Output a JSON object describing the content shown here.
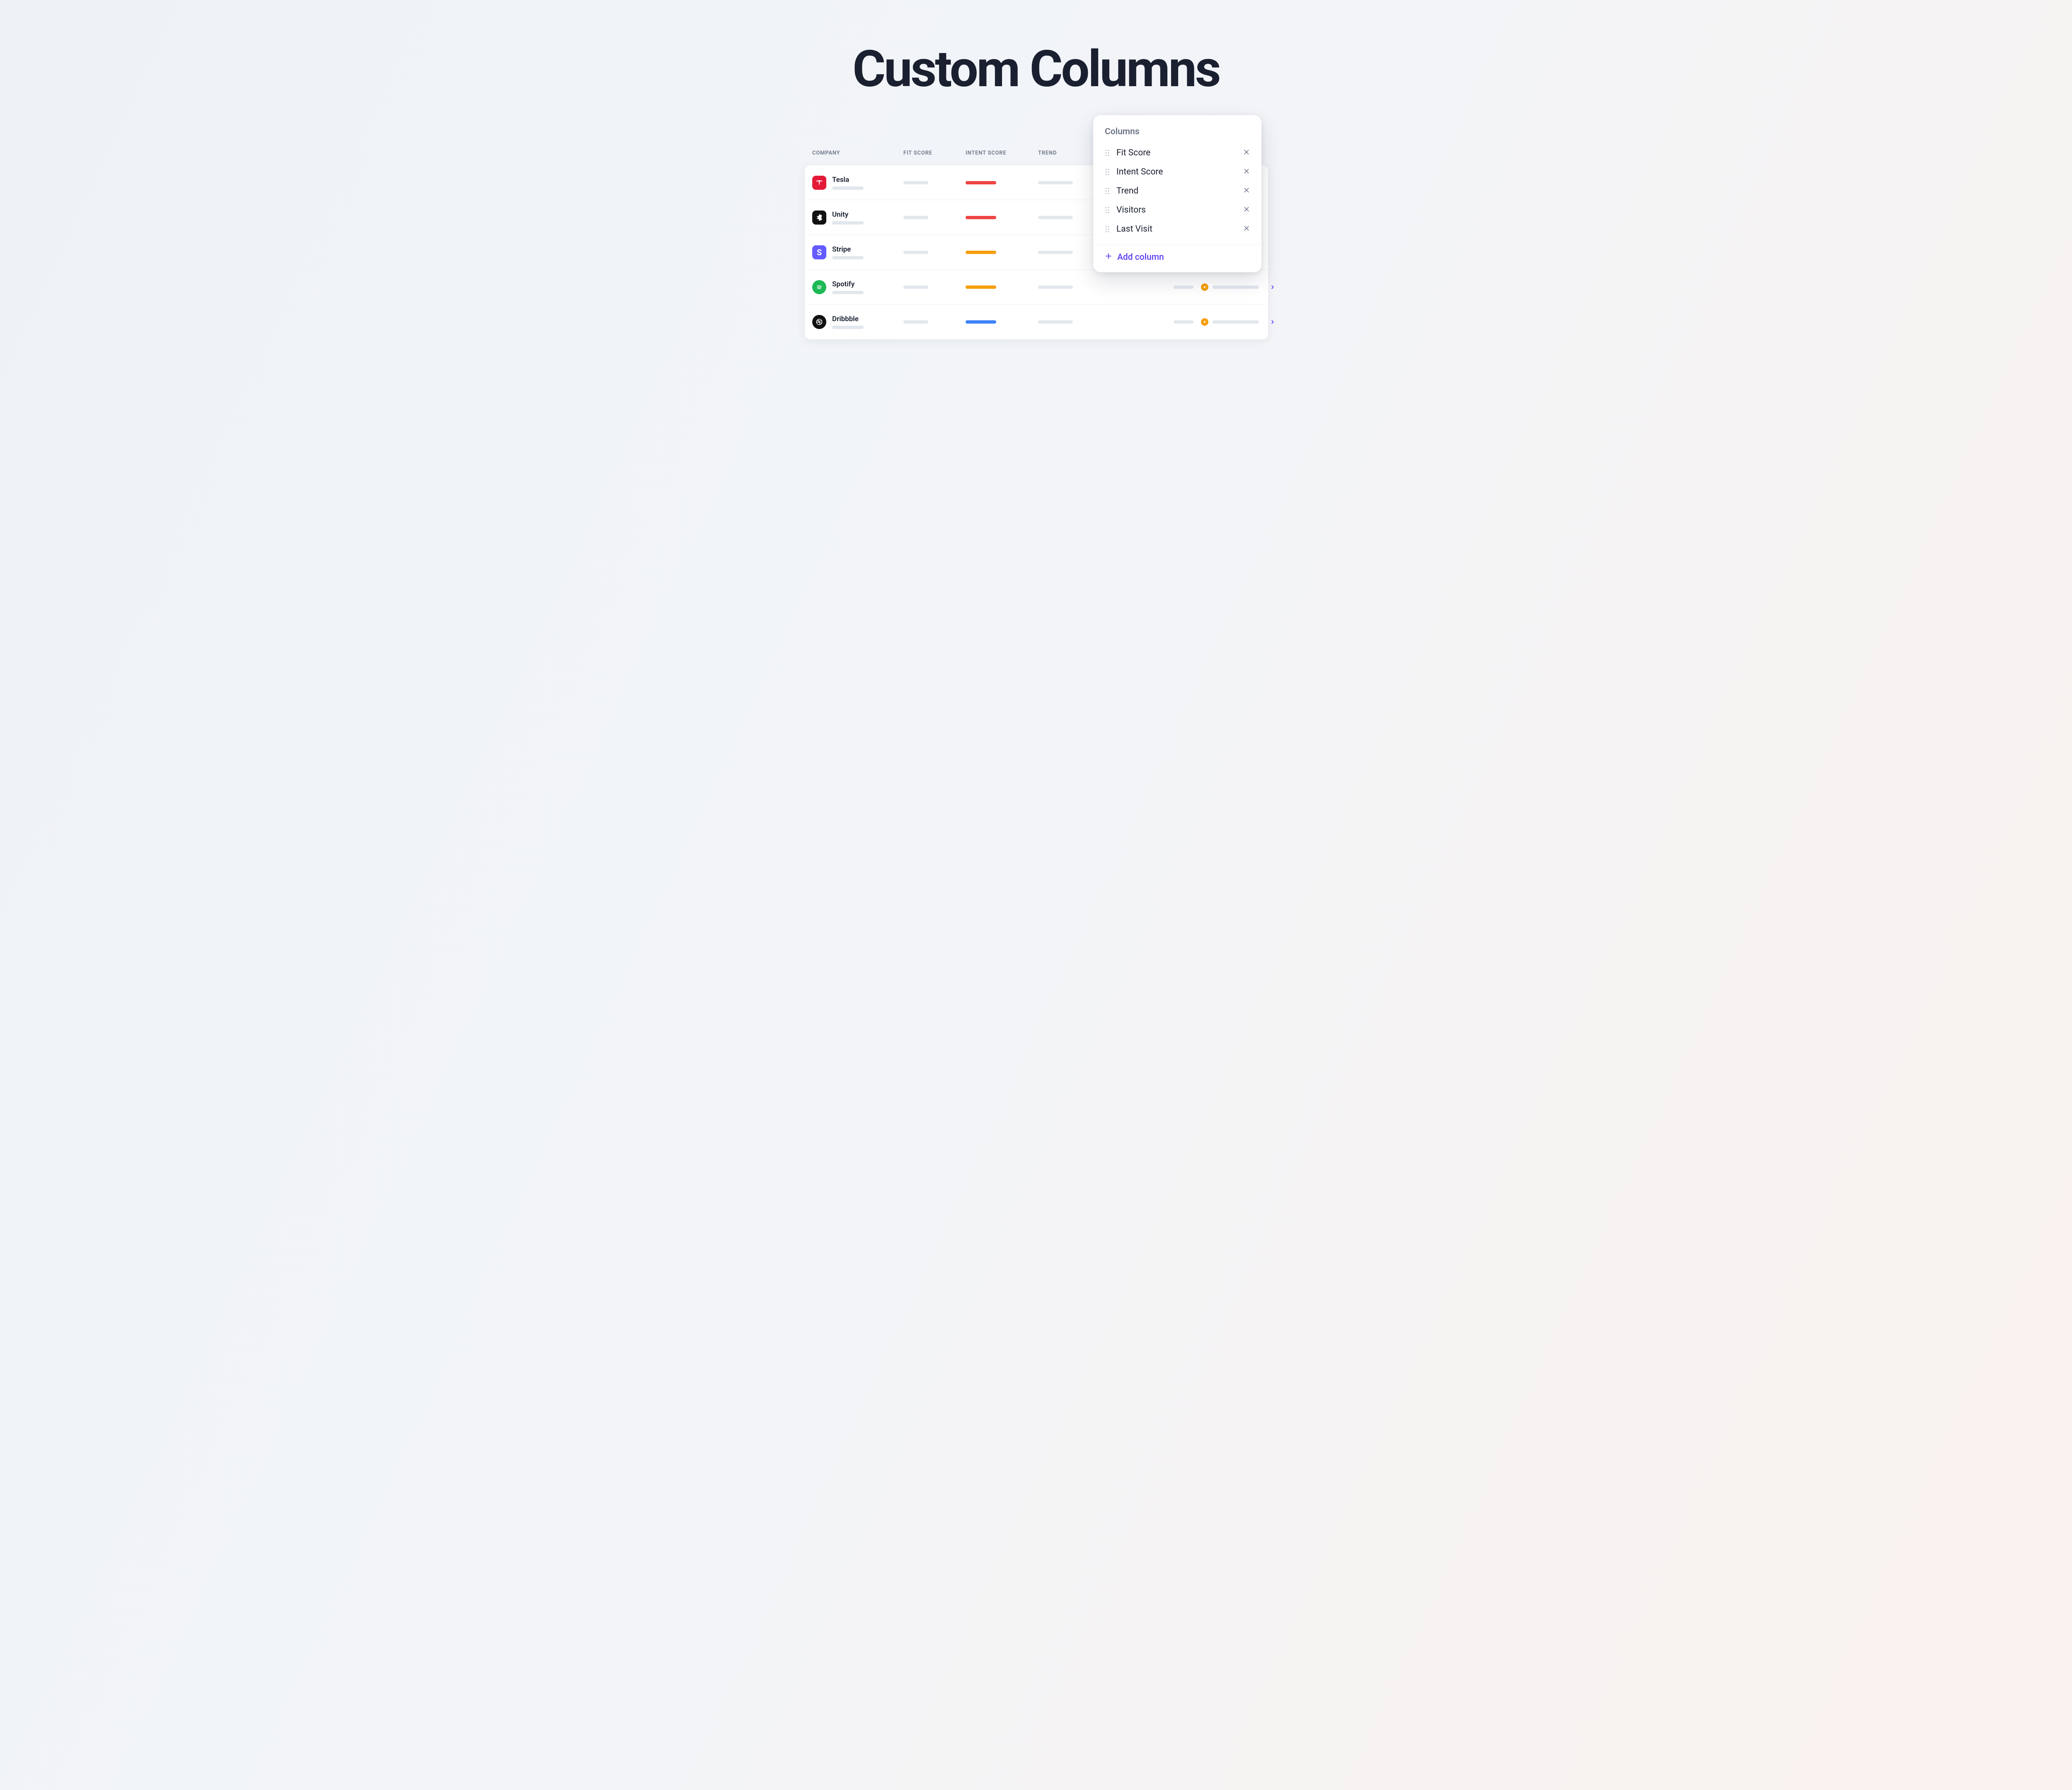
{
  "hero": {
    "title": "Custom Columns"
  },
  "table": {
    "headers": {
      "company": "COMPANY",
      "fit_score": "FIT SCORE",
      "intent_score": "INTENT SCORE",
      "trend": "TREND"
    },
    "rows": [
      {
        "name": "Tesla",
        "logo": "tesla",
        "intent_color": "red"
      },
      {
        "name": "Unity",
        "logo": "unity",
        "intent_color": "red"
      },
      {
        "name": "Stripe",
        "logo": "stripe",
        "intent_color": "orange"
      },
      {
        "name": "Spotify",
        "logo": "spotify",
        "intent_color": "orange"
      },
      {
        "name": "Dribbble",
        "logo": "dribbble",
        "intent_color": "blue"
      }
    ]
  },
  "popover": {
    "title": "Columns",
    "items": [
      {
        "label": "Fit Score"
      },
      {
        "label": "Intent Score"
      },
      {
        "label": "Trend"
      },
      {
        "label": "Visitors"
      },
      {
        "label": "Last Visit"
      }
    ],
    "add_label": "Add column"
  },
  "icons": {
    "bolt": "bolt-icon",
    "chevron": "chevron-right-icon",
    "close": "close-icon",
    "drag": "drag-handle-icon",
    "plus": "plus-icon"
  },
  "colors": {
    "red": "#ef4444",
    "orange": "#f59e0b",
    "blue": "#3b82f6",
    "accent": "#5b3df5"
  }
}
